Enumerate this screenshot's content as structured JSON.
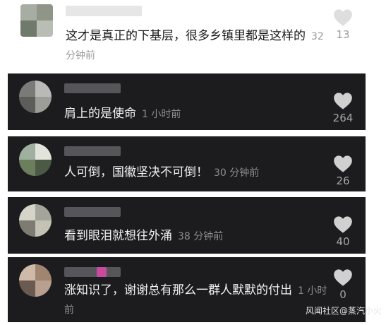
{
  "comments": [
    {
      "text": "这才是真正的下基层，很多乡镇里都是这样的",
      "time": "32分钟前",
      "likes": "13",
      "avatar_colors": [
        "#a8ada4",
        "#8f9688",
        "#6f7a6c",
        "#b9bdb5"
      ],
      "theme": "light"
    },
    {
      "text": "肩上的是使命",
      "time": "1 小时前",
      "likes": "264",
      "avatar_colors": [
        "#7a7a78",
        "#b9b9b5",
        "#5d5d5a",
        "#9c9c98"
      ],
      "theme": "dark"
    },
    {
      "text": "人可倒，国徽坚决不可倒！",
      "time": "30 分钟前",
      "likes": "26",
      "avatar_colors": [
        "#9fb0a0",
        "#e2e4dc",
        "#6c7f5d",
        "#4c5a45"
      ],
      "theme": "dark"
    },
    {
      "text": "看到眼泪就想往外涌",
      "time": "38 分钟前",
      "likes": "40",
      "avatar_colors": [
        "#d6d3c8",
        "#a5a49b",
        "#7d7b72",
        "#c4c1b5"
      ],
      "theme": "dark"
    },
    {
      "text": "涨知识了，谢谢总有那么一群人默默的付出",
      "time": "1 小时前",
      "likes": "0",
      "avatar_colors": [
        "#cfb9a8",
        "#a08570",
        "#6b5a50",
        "#b8a090"
      ],
      "theme": "dark",
      "name_tag_color": "#c84ba0"
    }
  ],
  "watermark": "风闻社区@蒸汽小火"
}
